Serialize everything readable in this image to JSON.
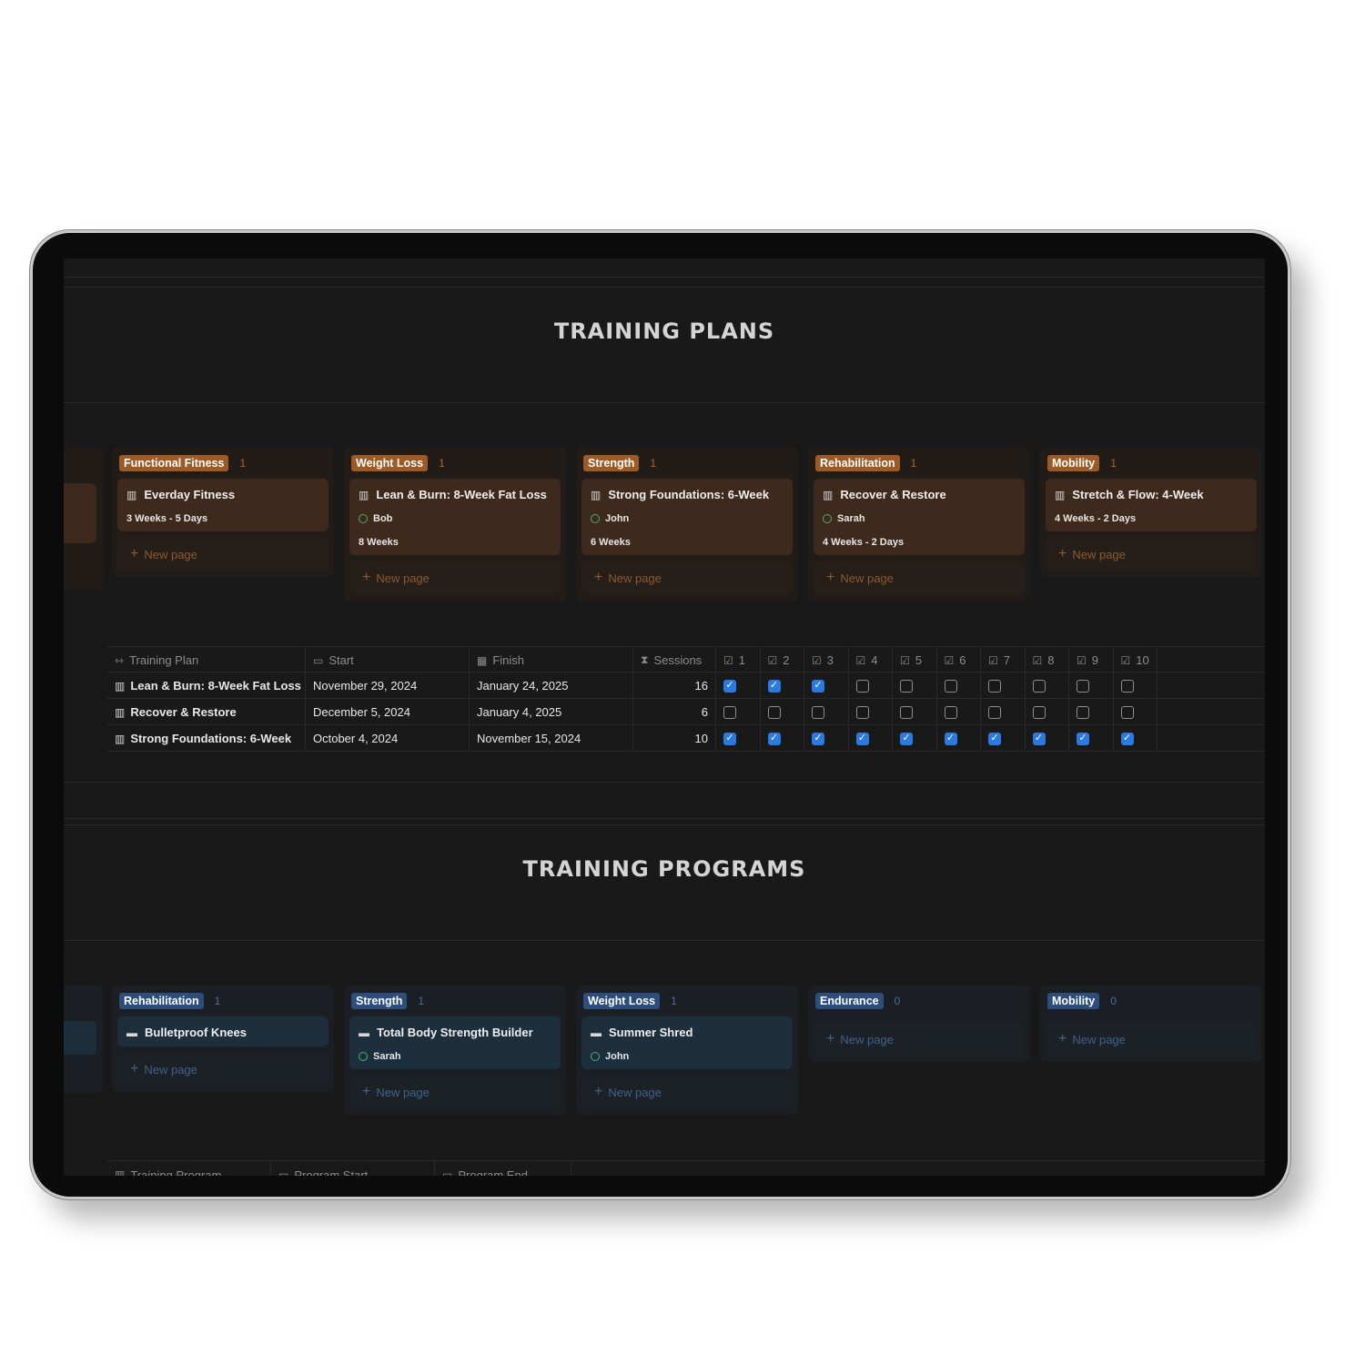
{
  "sections": {
    "plans_title": "TRAINING PLANS",
    "programs_title": "TRAINING PROGRAMS"
  },
  "plans_board": [
    {
      "group": "Functional Fitness",
      "count": "1",
      "card": {
        "title": "Everday Fitness",
        "person": "",
        "meta": "3 Weeks - 5 Days"
      },
      "new_page": "New page"
    },
    {
      "group": "Weight Loss",
      "count": "1",
      "card": {
        "title": "Lean & Burn: 8-Week Fat Loss",
        "person": "Bob",
        "meta": "8 Weeks"
      },
      "new_page": "New page"
    },
    {
      "group": "Strength",
      "count": "1",
      "card": {
        "title": "Strong Foundations: 6-Week",
        "person": "John",
        "meta": "6 Weeks"
      },
      "new_page": "New page"
    },
    {
      "group": "Rehabilitation",
      "count": "1",
      "card": {
        "title": "Recover & Restore",
        "person": "Sarah",
        "meta": "4 Weeks - 2 Days"
      },
      "new_page": "New page"
    },
    {
      "group": "Mobility",
      "count": "1",
      "card": {
        "title": "Stretch & Flow: 4-Week",
        "person": "",
        "meta": "4 Weeks - 2 Days"
      },
      "new_page": "New page"
    }
  ],
  "plans_table": {
    "headers": {
      "plan": "Training Plan",
      "start": "Start",
      "finish": "Finish",
      "sessions": "Sessions"
    },
    "session_cols": [
      "1",
      "2",
      "3",
      "4",
      "5",
      "6",
      "7",
      "8",
      "9",
      "10"
    ],
    "rows": [
      {
        "plan": "Lean & Burn: 8-Week Fat Loss",
        "start": "November 29, 2024",
        "finish": "January 24, 2025",
        "sessions": "16",
        "checks": [
          true,
          true,
          true,
          false,
          false,
          false,
          false,
          false,
          false,
          false
        ]
      },
      {
        "plan": "Recover & Restore",
        "start": "December 5, 2024",
        "finish": "January 4, 2025",
        "sessions": "6",
        "checks": [
          false,
          false,
          false,
          false,
          false,
          false,
          false,
          false,
          false,
          false
        ]
      },
      {
        "plan": "Strong Foundations: 6-Week",
        "start": "October 4, 2024",
        "finish": "November 15, 2024",
        "sessions": "10",
        "checks": [
          true,
          true,
          true,
          true,
          true,
          true,
          true,
          true,
          true,
          true
        ]
      }
    ]
  },
  "programs_board": [
    {
      "group": "Rehabilitation",
      "count": "1",
      "card": {
        "title": "Bulletproof Knees",
        "person": ""
      },
      "new_page": "New page"
    },
    {
      "group": "Strength",
      "count": "1",
      "card": {
        "title": "Total Body Strength Builder",
        "person": "Sarah"
      },
      "new_page": "New page"
    },
    {
      "group": "Weight Loss",
      "count": "1",
      "card": {
        "title": "Summer Shred",
        "person": "John"
      },
      "new_page": "New page"
    },
    {
      "group": "Endurance",
      "count": "0",
      "card": null,
      "new_page": "New page"
    },
    {
      "group": "Mobility",
      "count": "0",
      "card": null,
      "new_page": "New page"
    }
  ],
  "programs_table": {
    "headers": {
      "program": "Training Program",
      "start": "Program Start",
      "end": "Program End"
    }
  },
  "colors": {
    "brown_tag": "#9c5b26",
    "blue_tag": "#2d4e7a",
    "checkbox_on": "#2a7ae0",
    "background": "#191919"
  }
}
